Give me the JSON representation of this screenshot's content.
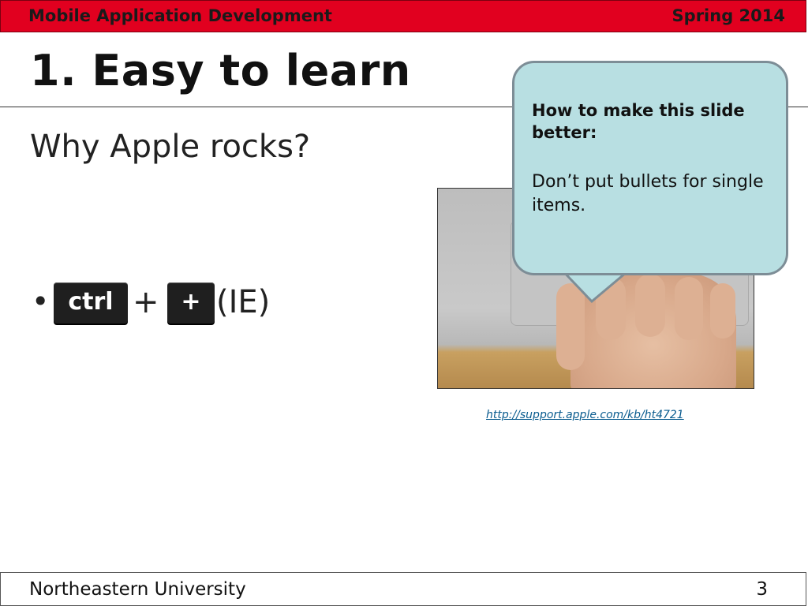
{
  "header": {
    "course": "Mobile Application Development",
    "term": "Spring 2014"
  },
  "slide": {
    "title": "1. Easy to learn",
    "subtitle": "Why Apple rocks?",
    "bullet": {
      "key1": "ctrl",
      "plus": "+",
      "key2": "+",
      "browser": "(IE)"
    },
    "link": "http://support.apple.com/kb/ht4721"
  },
  "callout": {
    "heading": "How to make this slide better:",
    "advice": "Don’t put bullets for single items."
  },
  "footer": {
    "institution": "Northeastern University",
    "page_number": "3"
  },
  "colors": {
    "header_bar": "#e1001f",
    "callout_fill": "#b8dfe2",
    "link": "#0a5c8f"
  }
}
